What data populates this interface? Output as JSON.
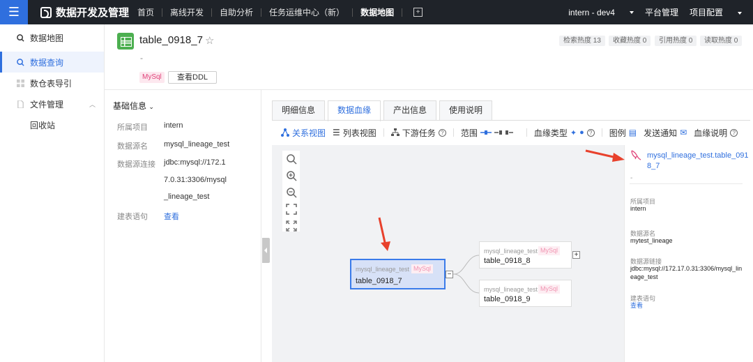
{
  "topbar": {
    "menu_icon": "hamburger-icon",
    "brand": "数据开发及管理",
    "nav": [
      "首页",
      "离线开发",
      "自助分析",
      "任务运维中心（新）",
      "数据地图"
    ],
    "active_nav": "数据地图",
    "user": "intern - dev4",
    "platform": "平台管理",
    "project": "项目配置"
  },
  "sidebar": {
    "items": [
      {
        "label": "数据地图"
      },
      {
        "label": "数据查询"
      },
      {
        "label": "数仓表导引"
      },
      {
        "label": "文件管理"
      },
      {
        "label": "回收站"
      }
    ]
  },
  "table": {
    "name": "table_0918_7",
    "desc": "-",
    "engine_tag": "MySql",
    "ddl_button": "查看DDL",
    "heat": [
      "检索热度 13",
      "收藏热度 0",
      "引用热度 0",
      "读取热度 0"
    ]
  },
  "basic_info": {
    "title": "基础信息",
    "project_label": "所属项目",
    "project": "intern",
    "datasource_label": "数据源名",
    "datasource": "mysql_lineage_test",
    "conn_label": "数据源连接",
    "conn_lines": [
      "jdbc:mysql://172.1",
      "7.0.31:3306/mysql",
      "_lineage_test"
    ],
    "ddl_label": "建表语句",
    "ddl_link": "查看"
  },
  "tabs": [
    "明细信息",
    "数据血缘",
    "产出信息",
    "使用说明"
  ],
  "active_tab": "数据血缘",
  "toolbar": {
    "relation_view": "关系视图",
    "list_view": "列表视图",
    "downstream": "下游任务",
    "range": "范围",
    "lineage_type": "血缘类型",
    "legend": "图例",
    "notify": "发送通知",
    "lineage_desc": "血缘说明"
  },
  "graph": {
    "nodes": [
      {
        "src": "mysql_lineage_test",
        "tag": "MySql",
        "name": "table_0918_7"
      },
      {
        "src": "mysql_lineage_test",
        "tag": "MySql",
        "name": "table_0918_8"
      },
      {
        "src": "mysql_lineage_test",
        "tag": "MySql",
        "name": "table_0918_9"
      }
    ],
    "collapse_symbol": "−",
    "expand_symbol": "+"
  },
  "detail": {
    "title": "mysql_lineage_test.table_0918_7",
    "desc": "-",
    "project_label": "所属项目",
    "project": "intern",
    "datasource_label": "数据源名",
    "datasource": "mytest_lineage",
    "conn_label": "数据源链接",
    "conn": "jdbc:mysql://172.17.0.31:3306/mysql_lineage_test",
    "ddl_label": "建表语句",
    "ddl_link": "查看"
  },
  "colors": {
    "accent": "#2f6fde",
    "topbar": "#1f2329",
    "mysql_tag": "#e0447a",
    "arrow": "#e8412c"
  }
}
